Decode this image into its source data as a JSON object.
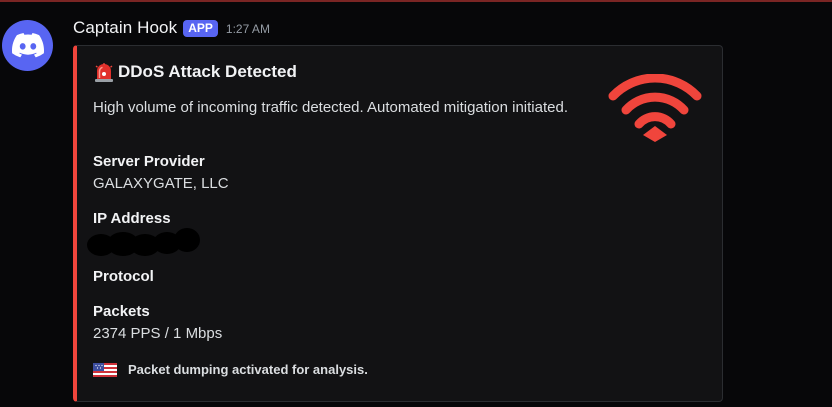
{
  "message": {
    "author": "Captain Hook",
    "badge": "APP",
    "timestamp": "1:27 AM"
  },
  "embed": {
    "accent_color": "#f0453c",
    "title": "DDoS Attack Detected",
    "title_icon": "rotating-light-siren-icon",
    "description": "High volume of incoming traffic detected. Automated mitigation initiated.",
    "fields": [
      {
        "name": "Server Provider",
        "value": "GALAXYGATE, LLC"
      },
      {
        "name": "IP Address",
        "value": ""
      },
      {
        "name": "Protocol",
        "value": ""
      },
      {
        "name": "Packets",
        "value": "2374 PPS / 1 Mbps"
      }
    ],
    "thumbnail_icon": "wifi-signal-icon",
    "footer": {
      "icon": "us-flag-icon",
      "text": "Packet dumping activated for analysis."
    }
  },
  "colors": {
    "background": "#070709",
    "embed_background": "#121214",
    "brand": "#5865f2",
    "accent": "#f0453c"
  }
}
